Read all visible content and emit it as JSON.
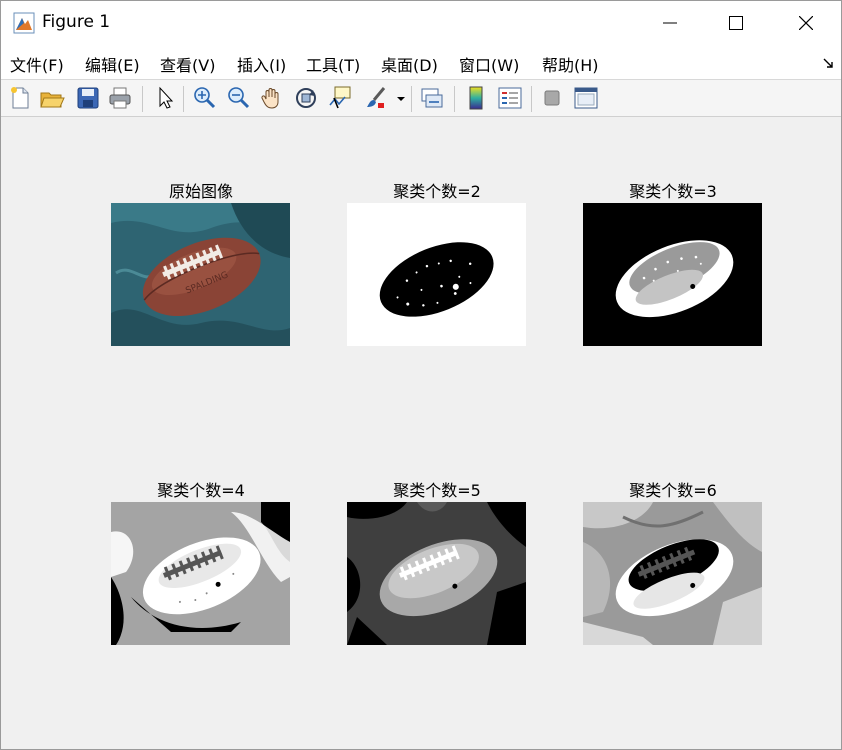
{
  "window": {
    "title": "Figure 1",
    "icon": "matlab-figure-icon"
  },
  "menu": [
    {
      "label": "文件(F)"
    },
    {
      "label": "编辑(E)"
    },
    {
      "label": "查看(V)"
    },
    {
      "label": "插入(I)"
    },
    {
      "label": "工具(T)"
    },
    {
      "label": "桌面(D)"
    },
    {
      "label": "窗口(W)"
    },
    {
      "label": "帮助(H)"
    }
  ],
  "toolbar": [
    "new-figure-icon",
    "open-file-icon",
    "save-icon",
    "print-icon",
    "pointer-icon",
    "zoom-in-icon",
    "zoom-out-icon",
    "pan-hand-icon",
    "rotate-3d-icon",
    "data-cursor-icon",
    "brush-icon",
    "link-plot-icon",
    "colorbar-icon",
    "legend-icon",
    "hide-plot-tools-icon",
    "show-plot-tools-icon"
  ],
  "figures": [
    {
      "title": "原始图像"
    },
    {
      "title": "聚类个数=2"
    },
    {
      "title": "聚类个数=3"
    },
    {
      "title": "聚类个数=4"
    },
    {
      "title": "聚类个数=5"
    },
    {
      "title": "聚类个数=6"
    }
  ],
  "colors": {
    "window_bg": "#f0f0f0",
    "cloth_teal": "#2e6472",
    "ball_brown": "#8a4436"
  }
}
